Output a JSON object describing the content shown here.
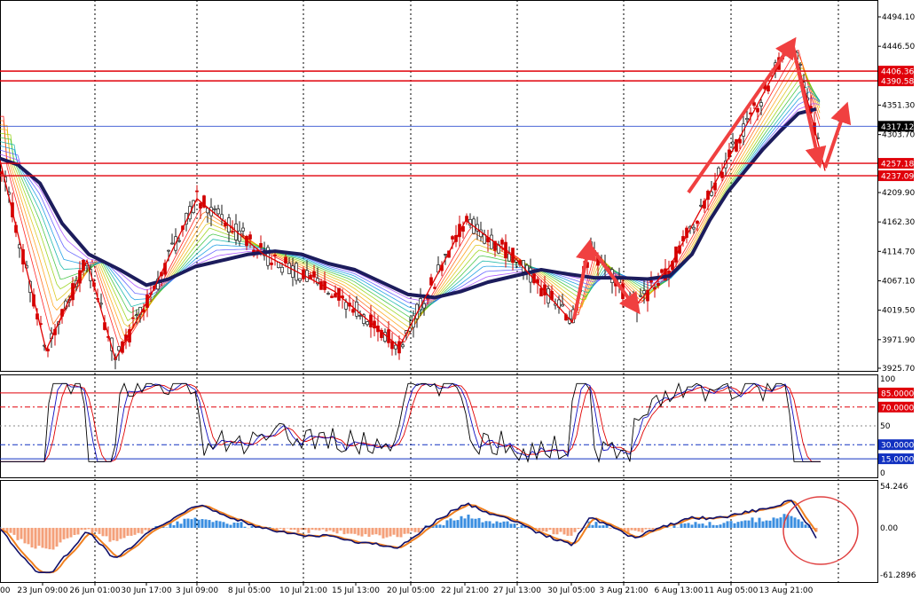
{
  "chart_data": {
    "type": "line",
    "panels": [
      {
        "name": "price",
        "ylim": [
          3925.7,
          4494.1
        ],
        "y_ticks": [
          "4494.10",
          "4446.50",
          "4351.30",
          "4303.70",
          "4209.90",
          "4162.30",
          "4114.70",
          "4067.10",
          "4019.50",
          "3971.90",
          "3925.70"
        ],
        "hlines": [
          {
            "value": 4406.36,
            "label": "4406.36",
            "color": "#e0000a"
          },
          {
            "value": 4390.58,
            "label": "4390.58",
            "color": "#e0000a"
          },
          {
            "value": 4317.12,
            "label": "4317.12",
            "color": "#3050d0"
          },
          {
            "value": 4257.18,
            "label": "4257.18",
            "color": "#e0000a"
          },
          {
            "value": 4237.09,
            "label": "4237.09",
            "color": "#e0000a"
          }
        ],
        "zigzag": [
          [
            0,
            4262
          ],
          [
            52,
            3955
          ],
          [
            98,
            4100
          ],
          [
            130,
            3940
          ],
          [
            172,
            4050
          ],
          [
            222,
            4200
          ],
          [
            297,
            4110
          ],
          [
            377,
            4050
          ],
          [
            450,
            3960
          ],
          [
            525,
            4165
          ],
          [
            580,
            4105
          ],
          [
            645,
            4000
          ],
          [
            665,
            4120
          ],
          [
            715,
            4025
          ],
          [
            755,
            4090
          ],
          [
            893,
            4456
          ],
          [
            930,
            4245
          ],
          [
            952,
            4340
          ]
        ],
        "slow_ma": [
          [
            0,
            4265
          ],
          [
            20,
            4255
          ],
          [
            45,
            4225
          ],
          [
            70,
            4160
          ],
          [
            100,
            4110
          ],
          [
            135,
            4085
          ],
          [
            165,
            4060
          ],
          [
            190,
            4070
          ],
          [
            220,
            4090
          ],
          [
            250,
            4100
          ],
          [
            280,
            4110
          ],
          [
            310,
            4115
          ],
          [
            340,
            4110
          ],
          [
            370,
            4095
          ],
          [
            400,
            4085
          ],
          [
            430,
            4065
          ],
          [
            460,
            4045
          ],
          [
            490,
            4040
          ],
          [
            520,
            4050
          ],
          [
            550,
            4065
          ],
          [
            580,
            4075
          ],
          [
            610,
            4085
          ],
          [
            640,
            4078
          ],
          [
            670,
            4072
          ],
          [
            700,
            4072
          ],
          [
            730,
            4070
          ],
          [
            755,
            4075
          ],
          [
            780,
            4110
          ],
          [
            800,
            4165
          ],
          [
            820,
            4210
          ],
          [
            840,
            4245
          ],
          [
            860,
            4280
          ],
          [
            880,
            4310
          ],
          [
            900,
            4338
          ],
          [
            920,
            4345
          ]
        ],
        "arrows": [
          [
            [
              647,
              4005
            ],
            [
              664,
              4124
            ]
          ],
          [
            [
              666,
              4122
            ],
            [
              717,
              4022
            ]
          ],
          [
            [
              776,
              4210
            ],
            [
              893,
              4452
            ]
          ],
          [
            [
              893,
              4452
            ],
            [
              923,
              4260
            ]
          ],
          [
            [
              930,
              4250
            ],
            [
              953,
              4346
            ]
          ]
        ]
      },
      {
        "name": "stochastic",
        "ylim": [
          0,
          100
        ],
        "y_ticks": [
          "100",
          "50",
          "0"
        ],
        "levels": [
          {
            "value": 85,
            "label": "85.0000",
            "color": "#e0000a"
          },
          {
            "value": 70,
            "label": "70.0000",
            "color": "#e0000a"
          },
          {
            "value": 30,
            "label": "30.0000",
            "color": "#1030c0"
          },
          {
            "value": 15,
            "label": "15.0000",
            "color": "#1030c0"
          }
        ]
      },
      {
        "name": "oscillator",
        "ylim": [
          -61.2896,
          54.246
        ],
        "y_ticks": [
          "54.246",
          "0.00",
          "-61.2896"
        ]
      }
    ],
    "x_ticks": [
      "23 Jun 09:00",
      "26 Jun 01:00",
      "30 Jun 17:00",
      "3 Jul 09:00",
      "8 Jul 05:00",
      "10 Jul 21:00",
      "15 Jul 13:00",
      "20 Jul 05:00",
      "22 Jul 21:00",
      "27 Jul 13:00",
      "30 Jul 05:00",
      "3 Aug 21:00",
      "6 Aug 13:00",
      "11 Aug 05:00",
      "13 Aug 21:00"
    ],
    "x_first_partial": "00",
    "grid": true
  }
}
